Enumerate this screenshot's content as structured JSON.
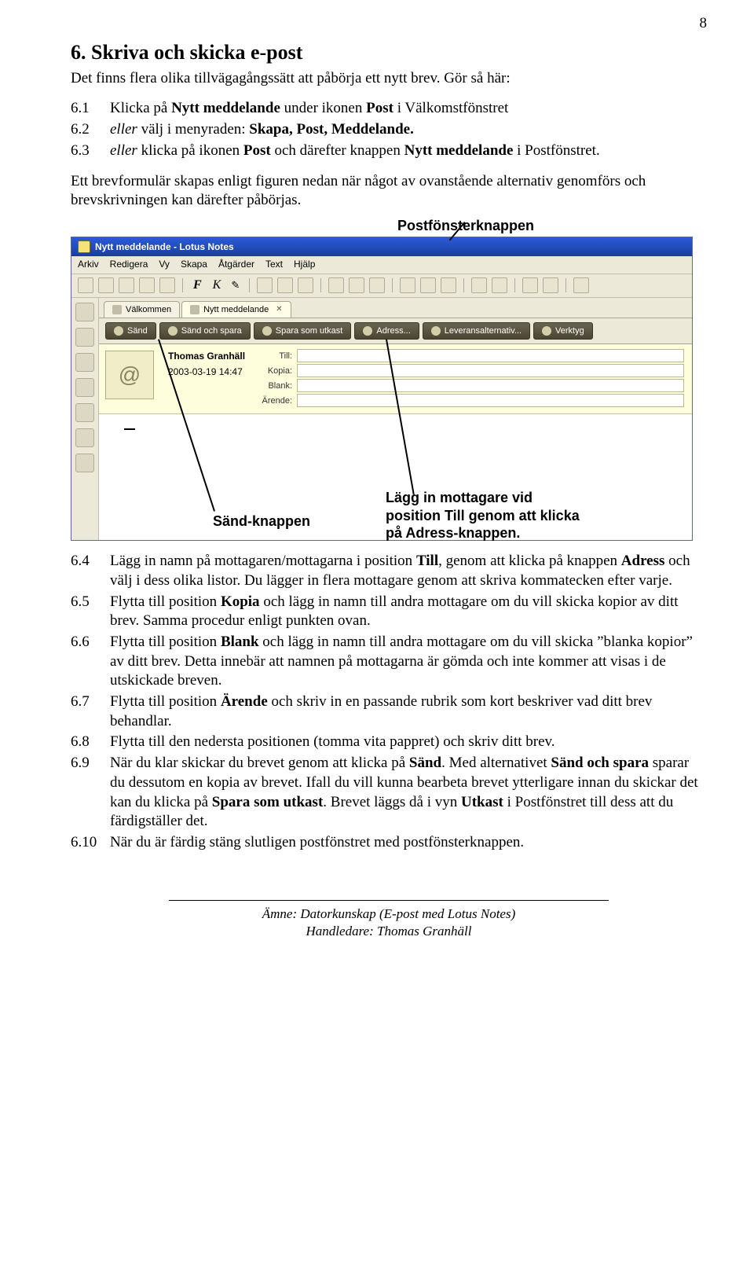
{
  "page_number": "8",
  "heading": "6. Skriva och skicka e-post",
  "intro": "Det finns flera olika tillvägagångssätt att påbörja ett nytt brev. Gör så här:",
  "list1": [
    {
      "num": "6.1",
      "txt": "Klicka på <b>Nytt meddelande</b> under ikonen <b>Post</b> i Välkomstfönstret"
    },
    {
      "num": "6.2",
      "txt": "<i>eller</i> välj i menyraden: <b>Skapa, Post, Meddelande.</b>"
    },
    {
      "num": "6.3",
      "txt": "<i>eller</i> klicka på ikonen <b>Post</b> och därefter knappen <b>Nytt meddelande</b> i Postfönstret."
    }
  ],
  "para1": "Ett brevformulär skapas enligt figuren nedan när något av ovanstående alternativ genomförs och brevskrivningen kan därefter påbörjas.",
  "callout_top": "Postfönsterknappen",
  "shot": {
    "title": "Nytt meddelande - Lotus Notes",
    "menu": [
      "Arkiv",
      "Redigera",
      "Vy",
      "Skapa",
      "Åtgärder",
      "Text",
      "Hjälp"
    ],
    "tabs": [
      {
        "label": "Välkommen",
        "close": false
      },
      {
        "label": "Nytt meddelande",
        "close": true
      }
    ],
    "actions": [
      "Sänd",
      "Sänd och spara",
      "Spara som utkast",
      "Adress...",
      "Leveransalternativ...",
      "Verktyg"
    ],
    "from": "Thomas Granhäll",
    "date": "2003-03-19 14:47",
    "fields": [
      "Till:",
      "Kopia:",
      "Blank:",
      "Ärende:"
    ]
  },
  "annot_sand": "Sänd-knappen",
  "annot_lagg": "Lägg in mottagare vid position Till genom att klicka på Adress-knappen.",
  "list2": [
    {
      "num": "6.4",
      "txt": "Lägg in namn på mottagaren/mottagarna i position <b>Till</b>, genom att klicka på knappen <b>Adress</b> och välj i dess olika listor. Du lägger in flera mottagare genom att skriva kommatecken efter varje."
    },
    {
      "num": "6.5",
      "txt": "Flytta till position <b>Kopia</b> och lägg in namn till andra mottagare om du vill skicka kopior av ditt brev. Samma procedur enligt punkten ovan."
    },
    {
      "num": "6.6",
      "txt": "Flytta till position <b>Blank</b> och lägg in namn till andra mottagare om du vill skicka ”blanka kopior” av ditt brev. Detta innebär att namnen på mottagarna är gömda och inte kommer att visas i de utskickade breven."
    },
    {
      "num": "6.7",
      "txt": "Flytta till position <b>Ärende</b> och skriv in en passande rubrik som kort beskriver vad ditt brev behandlar."
    },
    {
      "num": "6.8",
      "txt": "Flytta till den nedersta positionen (tomma vita pappret) och skriv ditt brev."
    },
    {
      "num": "6.9",
      "txt": "När du klar skickar du brevet genom att klicka på <b>Sänd</b>. Med alternativet <b>Sänd och spara</b> sparar du dessutom en kopia av brevet. Ifall du vill kunna bearbeta brevet ytterligare innan du skickar det kan du klicka på <b>Spara som utkast</b>. Brevet läggs då i vyn <b>Utkast</b> i Postfönstret till dess att du färdigställer det."
    },
    {
      "num": "6.10",
      "txt": "När du är färdig stäng slutligen postfönstret med postfönsterknappen."
    }
  ],
  "footer_subject": "Ämne: Datorkunskap (E-post med Lotus Notes)",
  "footer_by": "Handledare: Thomas Granhäll"
}
